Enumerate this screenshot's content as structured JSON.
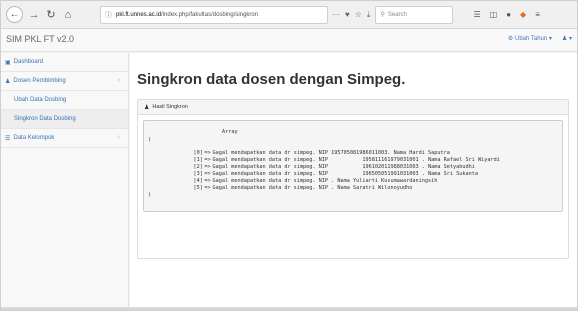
{
  "browser": {
    "url_host": "pkl.ft.unnes.ac.id",
    "url_path": "/index.php/fakultas/dosbing/singkron",
    "search_placeholder": "Search",
    "more_icon": "···",
    "pocket_icon": "♥",
    "bookmark_icon": "☆",
    "download_icon": "⤓"
  },
  "app": {
    "brand": "SIM PKL FT v2.0",
    "user_menu": [
      {
        "label": "Ubah Tahun ▾"
      },
      {
        "label": "▾"
      }
    ]
  },
  "sidebar": {
    "items": [
      {
        "label": "Dashboard",
        "icon": "dashboard-icon"
      },
      {
        "label": "Dosen Pembimbing",
        "icon": "user-icon",
        "arrow": "‹"
      },
      {
        "label": "Data Kelompok",
        "icon": "list-icon",
        "arrow": "‹"
      }
    ],
    "subitems": [
      {
        "label": "Ubah Data Dosbing"
      },
      {
        "label": "Singkron Data Dosbing"
      }
    ]
  },
  "main": {
    "title": "Singkron data dosen dengan Simpeg.",
    "panel_title": "Hasil Singkron",
    "array_label": "Array",
    "paren_open": "(",
    "paren_close": ")",
    "entries": [
      {
        "idx": "[0]",
        "arrow": "=>",
        "msg": "Gagal mendapatkan data dr simpeg. NIP ",
        "nip": "195705081986011003",
        "name_label": ". Nama ",
        "name": "Hardi Saputra"
      },
      {
        "idx": "[1]",
        "arrow": "=>",
        "msg": "Gagal mendapatkan data dr simpeg. NIP ",
        "nip": "          195811161979031001",
        "name_label": " . Nama ",
        "name": "Rafael Sri Wiyardi"
      },
      {
        "idx": "[2]",
        "arrow": "=>",
        "msg": "Gagal mendapatkan data dr simpeg. NIP ",
        "nip": "          196102011988031003",
        "name_label": " . Nama ",
        "name": "Setyabudhi"
      },
      {
        "idx": "[3]",
        "arrow": "=>",
        "msg": "Gagal mendapatkan data dr simpeg. NIP ",
        "nip": "          196505051991031003",
        "name_label": " . Nama ",
        "name": "Sri Sukanta"
      },
      {
        "idx": "[4]",
        "arrow": "=>",
        "msg": "Gagal mendapatkan data dr simpeg. NIP ",
        "nip": "",
        "name_label": ". Nama ",
        "name": "Yuliarti Kusumawardaningsih"
      },
      {
        "idx": "[5]",
        "arrow": "=>",
        "msg": "Gagal mendapatkan data dr simpeg. NIP ",
        "nip": "",
        "name_label": ". Nama ",
        "name": "Saratri Wilonoyudho"
      }
    ]
  },
  "colors": {
    "link": "#3a74b0",
    "panel_border": "#dddddd",
    "code_bg": "#f5f5f5"
  }
}
